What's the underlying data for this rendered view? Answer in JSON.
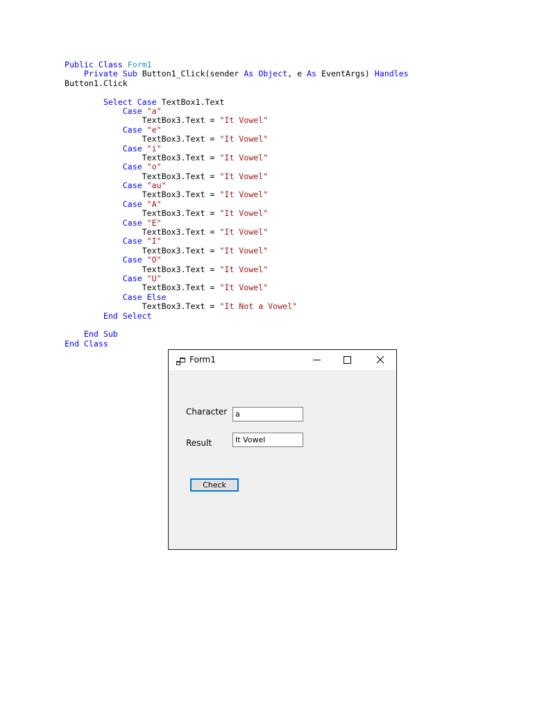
{
  "code": {
    "lines": [
      [
        "Public Class ",
        "Form1"
      ],
      [
        "    Private Sub ",
        "Button1_Click(sender ",
        "As Object",
        ", e ",
        "As",
        " EventArgs) ",
        "Handles"
      ],
      [
        "Button1.Click"
      ],
      [
        ""
      ],
      [
        "        Select Case ",
        "TextBox1.Text"
      ],
      [
        "            Case ",
        "\"a\""
      ],
      [
        "                TextBox3.Text = ",
        "\"It Vowel\""
      ],
      [
        "            Case ",
        "\"e\""
      ],
      [
        "                TextBox3.Text = ",
        "\"It Vowel\""
      ],
      [
        "            Case ",
        "\"i\""
      ],
      [
        "                TextBox3.Text = ",
        "\"It Vowel\""
      ],
      [
        "            Case ",
        "\"o\""
      ],
      [
        "                TextBox3.Text = ",
        "\"It Vowel\""
      ],
      [
        "            Case ",
        "\"au\""
      ],
      [
        "                TextBox3.Text = ",
        "\"It Vowel\""
      ],
      [
        "            Case ",
        "\"A\""
      ],
      [
        "                TextBox3.Text = ",
        "\"It Vowel\""
      ],
      [
        "            Case ",
        "\"E\""
      ],
      [
        "                TextBox3.Text = ",
        "\"It Vowel\""
      ],
      [
        "            Case ",
        "\"I\""
      ],
      [
        "                TextBox3.Text = ",
        "\"It Vowel\""
      ],
      [
        "            Case ",
        "\"O\""
      ],
      [
        "                TextBox3.Text = ",
        "\"It Vowel\""
      ],
      [
        "            Case ",
        "\"U\""
      ],
      [
        "                TextBox3.Text = ",
        "\"It Vowel\""
      ],
      [
        "            Case Else"
      ],
      [
        "                TextBox3.Text = ",
        "\"It Not a Vowel\""
      ],
      [
        "        End Select"
      ],
      [
        ""
      ],
      [
        "    End Sub"
      ],
      [
        "End Class"
      ]
    ],
    "classes": [
      [
        "kw",
        "ty"
      ],
      [
        "kw",
        "pl",
        "kw",
        "pl",
        "kw",
        "pl",
        "kw"
      ],
      [
        "pl"
      ],
      [
        "pl"
      ],
      [
        "kw",
        "pl"
      ],
      [
        "kw",
        "st"
      ],
      [
        "pl",
        "st"
      ],
      [
        "kw",
        "st"
      ],
      [
        "pl",
        "st"
      ],
      [
        "kw",
        "st"
      ],
      [
        "pl",
        "st"
      ],
      [
        "kw",
        "st"
      ],
      [
        "pl",
        "st"
      ],
      [
        "kw",
        "st"
      ],
      [
        "pl",
        "st"
      ],
      [
        "kw",
        "st"
      ],
      [
        "pl",
        "st"
      ],
      [
        "kw",
        "st"
      ],
      [
        "pl",
        "st"
      ],
      [
        "kw",
        "st"
      ],
      [
        "pl",
        "st"
      ],
      [
        "kw",
        "st"
      ],
      [
        "pl",
        "st"
      ],
      [
        "kw",
        "st"
      ],
      [
        "pl",
        "st"
      ],
      [
        "kw"
      ],
      [
        "pl",
        "st"
      ],
      [
        "kw"
      ],
      [
        "pl"
      ],
      [
        "kw"
      ],
      [
        "kw"
      ]
    ],
    "colors": {
      "keyword": "#0000ff",
      "type": "#2b91af",
      "string": "#a31515",
      "plain": "#000000"
    }
  },
  "window": {
    "title": "Form1",
    "icons": {
      "app": "app-form-icon",
      "minimize": "minimize-icon",
      "maximize": "maximize-icon",
      "close": "close-icon"
    },
    "character_label": "Character",
    "character_value": "a",
    "result_label": "Result",
    "result_value": "It Vowel",
    "check_button": "Check",
    "colors": {
      "background": "#f0f0f0",
      "titlebar": "#ffffff",
      "button_focus_border": "#0078d7"
    }
  }
}
